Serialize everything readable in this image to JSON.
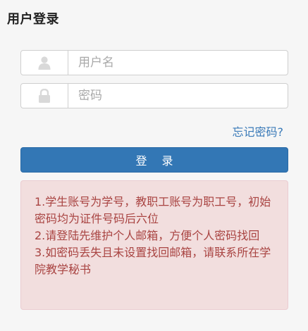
{
  "header": {
    "title": "用户登录"
  },
  "form": {
    "username": {
      "placeholder": "用户名",
      "icon": "user-icon"
    },
    "password": {
      "placeholder": "密码",
      "icon": "lock-icon"
    },
    "forgot_link": "忘记密码?",
    "login_button": "登 录"
  },
  "notice": {
    "lines": [
      "1.学生账号为学号，教职工账号为职工号，初始密码均为证件号码后六位",
      "2.请登陆先维护个人邮箱，方便个人密码找回",
      "3.如密码丢失且未设置找回邮箱，请联系所在学院教学秘书"
    ]
  },
  "colors": {
    "primary": "#3377b5",
    "link": "#3a7ab8",
    "alert_bg": "#f2dede",
    "alert_text": "#a94442"
  }
}
